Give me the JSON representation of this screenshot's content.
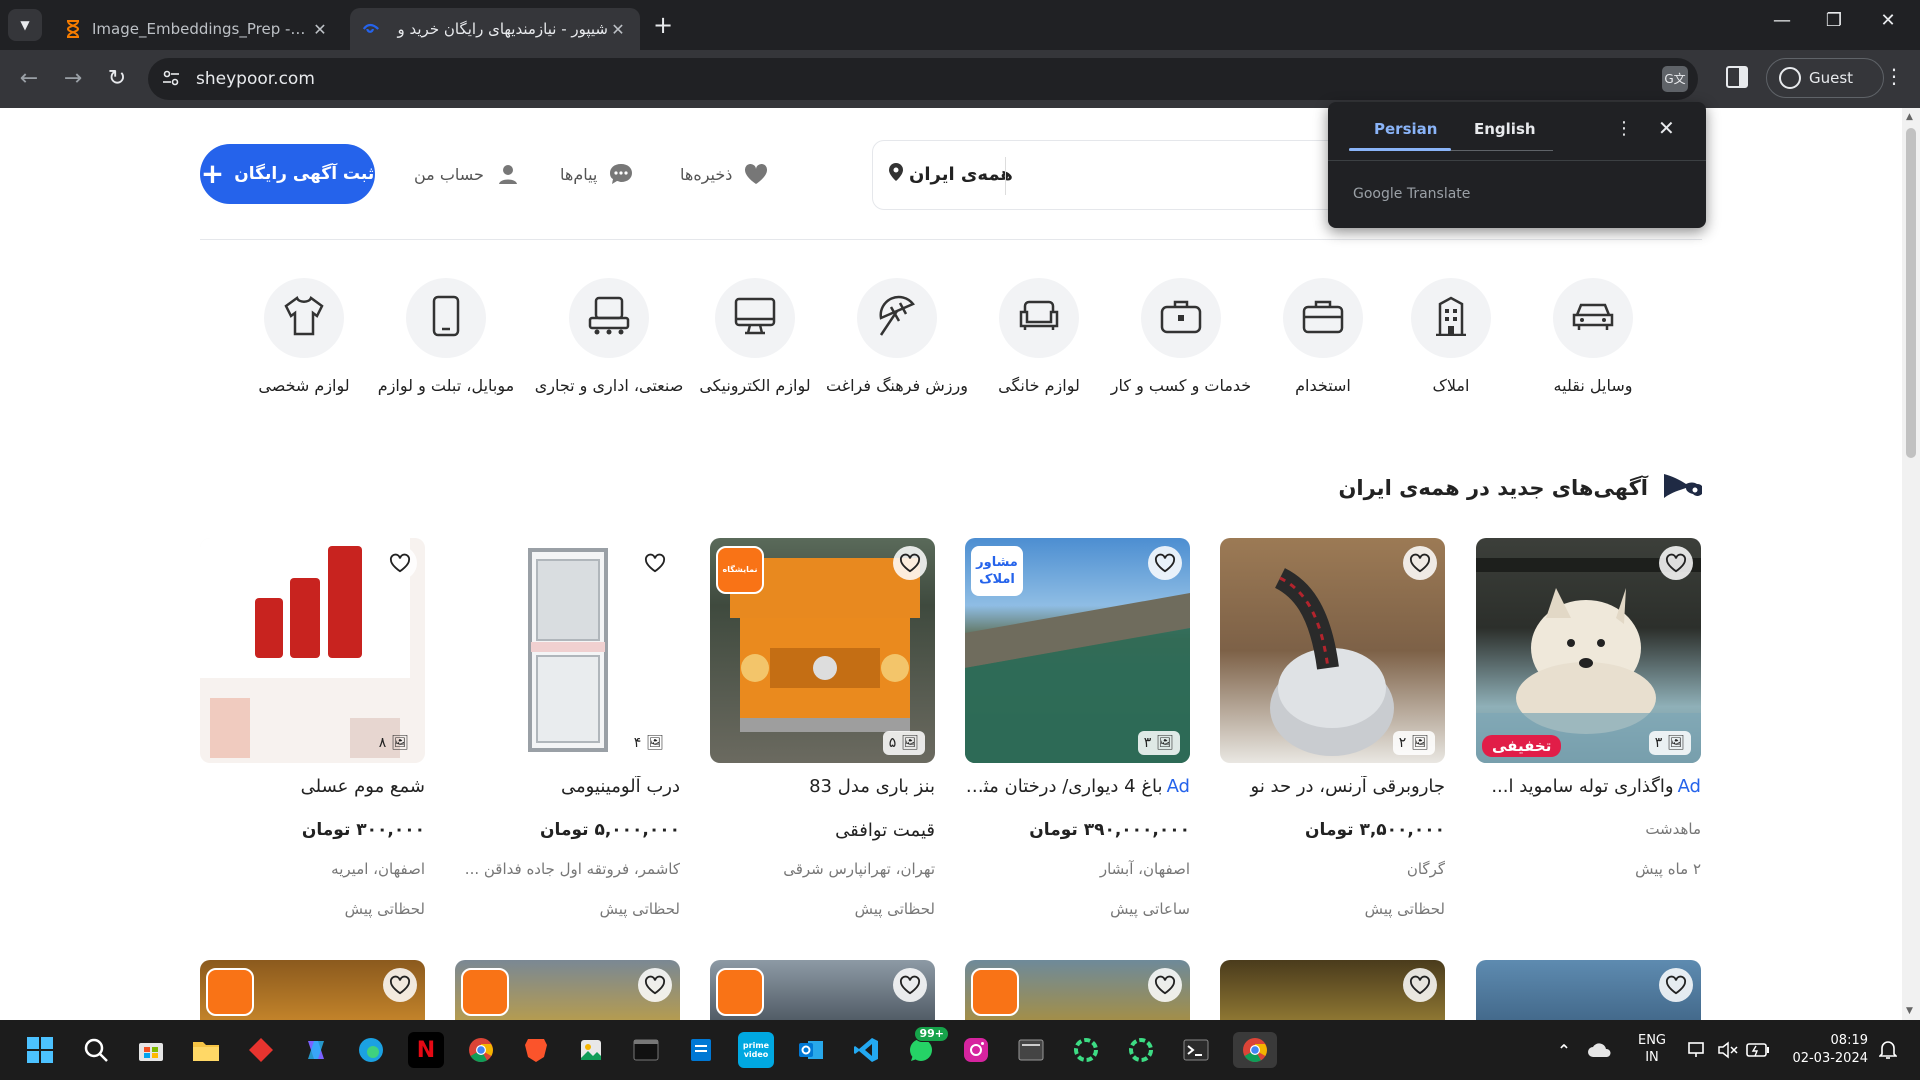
{
  "browser": {
    "tabs": [
      {
        "title": "Image_Embeddings_Prep - Jupyter",
        "active": false
      },
      {
        "title": "شیپور - نیازمندیهای رایگان خرید و",
        "active": true
      }
    ],
    "url": "sheypoor.com",
    "profile_label": "Guest"
  },
  "translate_popup": {
    "languages": [
      "Persian",
      "English"
    ],
    "selected": "Persian",
    "brand": "Google Translate"
  },
  "header": {
    "post_ad_label": "ثبت آگهی رایگان",
    "account_label": "حساب من",
    "messages_label": "پیام‌ها",
    "saved_label": "ذخیره‌ها",
    "location_label": "همه‌ی ایران"
  },
  "categories": [
    {
      "label": "وسایل نقلیه",
      "icon": "car-icon"
    },
    {
      "label": "املاک",
      "icon": "building-icon"
    },
    {
      "label": "استخدام",
      "icon": "briefcase-icon"
    },
    {
      "label": "خدمات و کسب و کار",
      "icon": "bag-icon"
    },
    {
      "label": "لوازم خانگی",
      "icon": "sofa-icon"
    },
    {
      "label": "ورزش فرهنگ فراغت",
      "icon": "umbrella-icon"
    },
    {
      "label": "لوازم الکترونیکی",
      "icon": "monitor-icon"
    },
    {
      "label": "صنعتی، اداری و تجاری",
      "icon": "machine-icon"
    },
    {
      "label": "موبایل، تبلت و لوازم",
      "icon": "mobile-icon"
    },
    {
      "label": "لوازم شخصی",
      "icon": "shirt-icon"
    }
  ],
  "section_title": "آگهی‌های جدید در همه‌ی ایران",
  "listings": [
    {
      "ad": "Ad",
      "title": "واگذاری توله ساموید ا...",
      "price": "ماهدشت",
      "location": "۲ ماه پیش",
      "time": "",
      "photos": "۳",
      "badge": "تخفیفی"
    },
    {
      "ad": "",
      "title": "جاروبرقی آرنس، در حد نو",
      "price": "۳,۵۰۰,۰۰۰ تومان",
      "location": "گرگان",
      "time": "لحظاتی پیش",
      "photos": "۲",
      "badge": ""
    },
    {
      "ad": "Ad",
      "title": "باغ 4 دیواری/ درختان مثـ...",
      "price": "۳۹۰,۰۰۰,۰۰۰ تومان",
      "location": "اصفهان، آبشار",
      "time": "ساعاتی پیش",
      "photos": "۳",
      "badge": "مشاور املاک"
    },
    {
      "ad": "",
      "title": "بنز باری مدل 83",
      "price": "قیمت توافقی",
      "location": "تهران، تهرانپارس شرقی",
      "time": "لحظاتی پیش",
      "photos": "۵",
      "badge": "نمایشگاه"
    },
    {
      "ad": "",
      "title": "درب آلومینیومی",
      "price": "۵,۰۰۰,۰۰۰ تومان",
      "location": "کاشمر، فروتقه اول جاده فداقن ...",
      "time": "لحظاتی پیش",
      "photos": "۴",
      "badge": ""
    },
    {
      "ad": "",
      "title": "شمع موم عسلی",
      "price": "۳۰۰,۰۰۰ تومان",
      "location": "اصفهان، امیریه",
      "time": "لحظاتی پیش",
      "photos": "۸",
      "badge": ""
    }
  ],
  "taskbar": {
    "whatsapp_badge": "99+",
    "lang_line1": "ENG",
    "lang_line2": "IN",
    "time": "08:19",
    "date": "02-03-2024"
  }
}
